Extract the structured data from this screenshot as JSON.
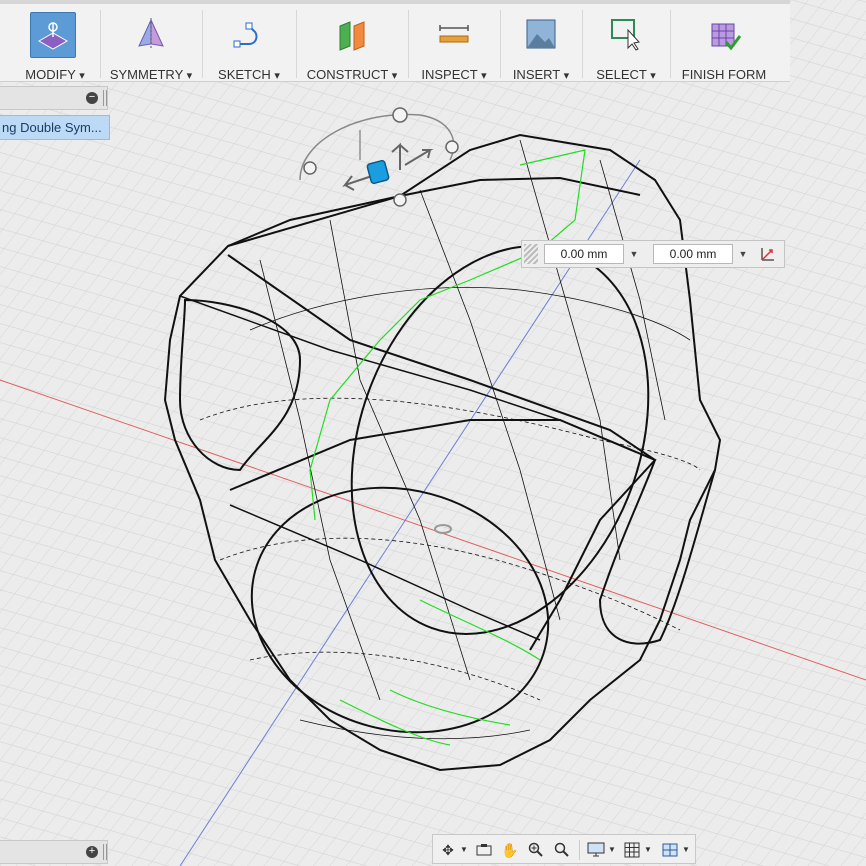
{
  "toolbar": {
    "items": [
      {
        "label": "MODIFY",
        "icon": "modify-icon"
      },
      {
        "label": "SYMMETRY",
        "icon": "symmetry-icon"
      },
      {
        "label": "SKETCH",
        "icon": "sketch-icon"
      },
      {
        "label": "CONSTRUCT",
        "icon": "construct-icon"
      },
      {
        "label": "INSPECT",
        "icon": "inspect-icon"
      },
      {
        "label": "INSERT",
        "icon": "insert-icon"
      },
      {
        "label": "SELECT",
        "icon": "select-icon"
      },
      {
        "label": "FINISH FORM",
        "icon": "finish-form-icon"
      }
    ],
    "dropdown_glyph": "▾"
  },
  "browser_panel": {
    "selected_item": "ng Double Sym...",
    "collapse_glyph": "−",
    "expand_glyph": "+"
  },
  "dimension_input": {
    "value1": "0.00 mm",
    "value2": "0.00 mm"
  },
  "navigation_bar": {
    "icons": [
      "orbit-icon",
      "look-at-icon",
      "pan-icon",
      "zoom-icon",
      "fit-icon",
      "display-settings-icon",
      "grid-icon",
      "viewports-icon"
    ]
  },
  "colors": {
    "accent": "#5c9bd5",
    "selection": "#bcd9f5",
    "grid": "#d0d0d0",
    "x_axis": "#e06060",
    "y_axis": "#6b7fd6",
    "green_edge": "#22dd22",
    "manipulator": "#1b9ee0"
  }
}
